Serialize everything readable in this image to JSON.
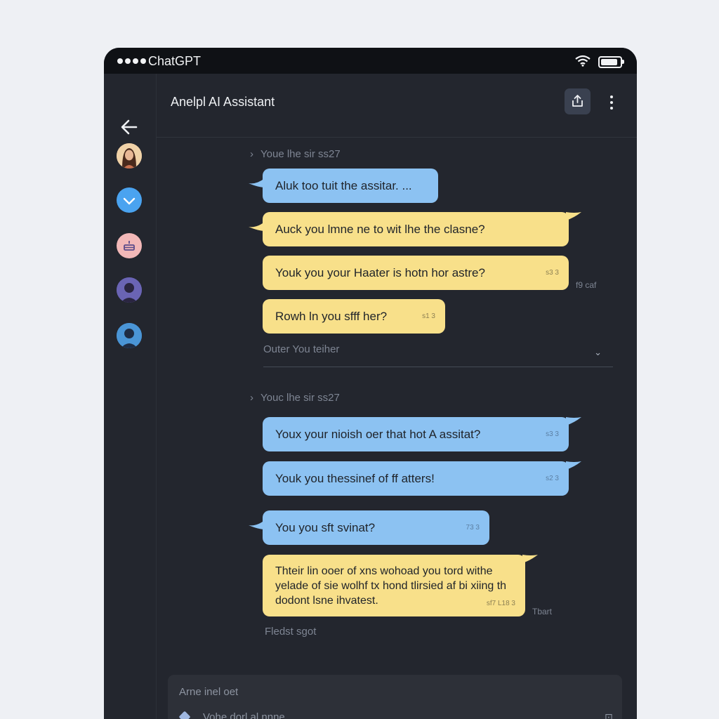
{
  "statusbar": {
    "carrier": "ChatGPT",
    "battery_level": 0.9
  },
  "header": {
    "title": "Anelpl AI Assistant"
  },
  "sidebar": {
    "avatars": [
      {
        "name": "avatar-woman",
        "color": "#e8b98a"
      },
      {
        "name": "avatar-check",
        "color": "#4aa3f0"
      },
      {
        "name": "avatar-cake",
        "color": "#f2b8b8"
      },
      {
        "name": "avatar-person-purple",
        "color": "#5a55a8"
      },
      {
        "name": "avatar-person-blue",
        "color": "#3d86c9"
      }
    ]
  },
  "sections": [
    {
      "label": "Youe lhe sir ss27"
    },
    {
      "label": "Youc lhe sir ss27"
    }
  ],
  "messages": [
    {
      "text": "Aluk too tuit the assitar. ...",
      "color": "blue",
      "time": ""
    },
    {
      "text": "Auck you lmne ne to wit lhe the clasne?",
      "color": "yellow",
      "time": ""
    },
    {
      "text": "Youk you your Haater is hotn hor astre?",
      "color": "yellow",
      "time": "s3 3",
      "side_time": "f9 caf"
    },
    {
      "text": "Rowh ln you sfff her?",
      "color": "yellow",
      "time": "s1 3"
    },
    {
      "text": "Youx your nioish oer that hot A assitat?",
      "color": "blue",
      "time": "s3 3"
    },
    {
      "text": "Youk you thessinef of ff atters!",
      "color": "blue",
      "time": "s2 3"
    },
    {
      "text": "You you sft svinat?",
      "color": "blue",
      "time": "73 3"
    },
    {
      "text": "Thteir lin ooer of xns wohoad you tord withe yelade of sie wolhf tx hond tlirsied af bi xiing th dodont lsne ihvatest.",
      "color": "yellow",
      "time": "sf7 L18 3",
      "side_time": "Tbart"
    }
  ],
  "divider": {
    "text": "Outer You teiher"
  },
  "footer_hint": "Fledst sgot",
  "composer": {
    "caption": "Arne inel oet",
    "placeholder": "Vohe dorl al nnne"
  }
}
